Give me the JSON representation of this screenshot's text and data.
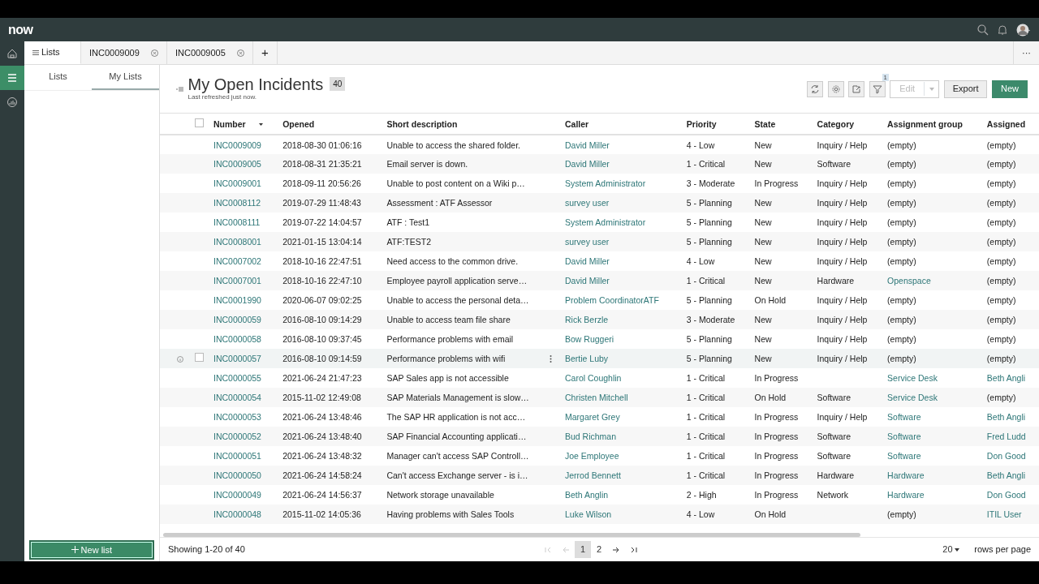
{
  "header": {
    "logo": "now"
  },
  "rail": [
    {
      "selected": false
    },
    {
      "selected": true
    },
    {
      "selected": false
    }
  ],
  "tabs": [
    {
      "label": "Lists",
      "kind": "menu",
      "selected": true
    },
    {
      "label": "INC0009009",
      "kind": "record",
      "selected": false
    },
    {
      "label": "INC0009005",
      "kind": "record",
      "selected": false
    },
    {
      "label": "+",
      "kind": "add",
      "selected": false
    }
  ],
  "more": "···",
  "panel_tabs": [
    {
      "label": "Lists",
      "selected": false
    },
    {
      "label": "My Lists",
      "selected": true
    }
  ],
  "new_list": "New list",
  "list": {
    "title": "My Open Incidents",
    "count": "40",
    "refreshed": "Last refreshed just now.",
    "filter_badge": "1",
    "buttons": [
      {
        "label": "Edit",
        "kind": "split",
        "disabled": true
      },
      {
        "label": "Export",
        "kind": "plain",
        "disabled": false
      },
      {
        "label": "New",
        "kind": "primary",
        "disabled": false
      }
    ]
  },
  "table": {
    "select_all_checked": false,
    "columns": [
      {
        "label": "Number",
        "sorted": true
      },
      {
        "label": "Opened",
        "sorted": false
      },
      {
        "label": "Short description",
        "sorted": false
      },
      {
        "label": "Caller",
        "sorted": false
      },
      {
        "label": "Priority",
        "sorted": false
      },
      {
        "label": "State",
        "sorted": false
      },
      {
        "label": "Category",
        "sorted": false
      },
      {
        "label": "Assignment group",
        "sorted": false
      },
      {
        "label": "Assigned",
        "sorted": false
      }
    ],
    "rows": [
      {
        "hovered": false,
        "cells": [
          "INC0009009",
          "2018-08-30 01:06:16",
          "Unable to access the shared folder.",
          "David Miller",
          "4 - Low",
          "New",
          "Inquiry / Help",
          "(empty)",
          "(empty)"
        ],
        "links": [
          true,
          false,
          false,
          true,
          false,
          false,
          false,
          false,
          false
        ]
      },
      {
        "hovered": false,
        "cells": [
          "INC0009005",
          "2018-08-31 21:35:21",
          "Email server is down.",
          "David Miller",
          "1 - Critical",
          "New",
          "Software",
          "(empty)",
          "(empty)"
        ],
        "links": [
          true,
          false,
          false,
          true,
          false,
          false,
          false,
          false,
          false
        ]
      },
      {
        "hovered": false,
        "cells": [
          "INC0009001",
          "2018-09-11 20:56:26",
          "Unable to post content on a Wiki p…",
          "System Administrator",
          "3 - Moderate",
          "In Progress",
          "Inquiry / Help",
          "(empty)",
          "(empty)"
        ],
        "links": [
          true,
          false,
          false,
          true,
          false,
          false,
          false,
          false,
          false
        ]
      },
      {
        "hovered": false,
        "cells": [
          "INC0008112",
          "2019-07-29 11:48:43",
          "Assessment :  ATF Assessor",
          "survey user",
          "5 - Planning",
          "New",
          "Inquiry / Help",
          "(empty)",
          "(empty)"
        ],
        "links": [
          true,
          false,
          false,
          true,
          false,
          false,
          false,
          false,
          false
        ]
      },
      {
        "hovered": false,
        "cells": [
          "INC0008111",
          "2019-07-22 14:04:57",
          "ATF : Test1",
          "System Administrator",
          "5 - Planning",
          "New",
          "Inquiry / Help",
          "(empty)",
          "(empty)"
        ],
        "links": [
          true,
          false,
          false,
          true,
          false,
          false,
          false,
          false,
          false
        ]
      },
      {
        "hovered": false,
        "cells": [
          "INC0008001",
          "2021-01-15 13:04:14",
          "ATF:TEST2",
          "survey user",
          "5 - Planning",
          "New",
          "Inquiry / Help",
          "(empty)",
          "(empty)"
        ],
        "links": [
          true,
          false,
          false,
          true,
          false,
          false,
          false,
          false,
          false
        ]
      },
      {
        "hovered": false,
        "cells": [
          "INC0007002",
          "2018-10-16 22:47:51",
          "Need access to the common drive.",
          "David Miller",
          "4 - Low",
          "New",
          "Inquiry / Help",
          "(empty)",
          "(empty)"
        ],
        "links": [
          true,
          false,
          false,
          true,
          false,
          false,
          false,
          false,
          false
        ]
      },
      {
        "hovered": false,
        "cells": [
          "INC0007001",
          "2018-10-16 22:47:10",
          "Employee payroll application serve…",
          "David Miller",
          "1 - Critical",
          "New",
          "Hardware",
          "Openspace",
          "(empty)"
        ],
        "links": [
          true,
          false,
          false,
          true,
          false,
          false,
          false,
          true,
          false
        ]
      },
      {
        "hovered": false,
        "cells": [
          "INC0001990",
          "2020-06-07 09:02:25",
          "Unable to access the personal deta…",
          "Problem CoordinatorATF",
          "5 - Planning",
          "On Hold",
          "Inquiry / Help",
          "(empty)",
          "(empty)"
        ],
        "links": [
          true,
          false,
          false,
          true,
          false,
          false,
          false,
          false,
          false
        ]
      },
      {
        "hovered": false,
        "cells": [
          "INC0000059",
          "2016-08-10 09:14:29",
          "Unable to access team file share",
          "Rick Berzle",
          "3 - Moderate",
          "New",
          "Inquiry / Help",
          "(empty)",
          "(empty)"
        ],
        "links": [
          true,
          false,
          false,
          true,
          false,
          false,
          false,
          false,
          false
        ]
      },
      {
        "hovered": false,
        "cells": [
          "INC0000058",
          "2016-08-10 09:37:45",
          "Performance problems with email",
          "Bow Ruggeri",
          "5 - Planning",
          "New",
          "Inquiry / Help",
          "(empty)",
          "(empty)"
        ],
        "links": [
          true,
          false,
          false,
          true,
          false,
          false,
          false,
          false,
          false
        ]
      },
      {
        "hovered": true,
        "cells": [
          "INC0000057",
          "2016-08-10 09:14:59",
          "Performance problems with wifi",
          "Bertie Luby",
          "5 - Planning",
          "New",
          "Inquiry / Help",
          "(empty)",
          "(empty)"
        ],
        "links": [
          true,
          false,
          false,
          true,
          false,
          false,
          false,
          false,
          false
        ]
      },
      {
        "hovered": false,
        "cells": [
          "INC0000055",
          "2021-06-24 21:47:23",
          "SAP Sales app is not accessible",
          "Carol Coughlin",
          "1 - Critical",
          "In Progress",
          "",
          "Service Desk",
          "Beth Angli"
        ],
        "links": [
          true,
          false,
          false,
          true,
          false,
          false,
          false,
          true,
          true
        ]
      },
      {
        "hovered": false,
        "cells": [
          "INC0000054",
          "2015-11-02 12:49:08",
          "SAP Materials Management is slow…",
          "Christen Mitchell",
          "1 - Critical",
          "On Hold",
          "Software",
          "Service Desk",
          "(empty)"
        ],
        "links": [
          true,
          false,
          false,
          true,
          false,
          false,
          false,
          true,
          false
        ]
      },
      {
        "hovered": false,
        "cells": [
          "INC0000053",
          "2021-06-24 13:48:46",
          "The SAP HR application is not acc…",
          "Margaret Grey",
          "1 - Critical",
          "In Progress",
          "Inquiry / Help",
          "Software",
          "Beth Angli"
        ],
        "links": [
          true,
          false,
          false,
          true,
          false,
          false,
          false,
          true,
          true
        ]
      },
      {
        "hovered": false,
        "cells": [
          "INC0000052",
          "2021-06-24 13:48:40",
          "SAP Financial Accounting applicati…",
          "Bud Richman",
          "1 - Critical",
          "In Progress",
          "Software",
          "Software",
          "Fred Ludd"
        ],
        "links": [
          true,
          false,
          false,
          true,
          false,
          false,
          false,
          true,
          true
        ]
      },
      {
        "hovered": false,
        "cells": [
          "INC0000051",
          "2021-06-24 13:48:32",
          "Manager can't access SAP Controll…",
          "Joe Employee",
          "1 - Critical",
          "In Progress",
          "Software",
          "Software",
          "Don Good"
        ],
        "links": [
          true,
          false,
          false,
          true,
          false,
          false,
          false,
          true,
          true
        ]
      },
      {
        "hovered": false,
        "cells": [
          "INC0000050",
          "2021-06-24 14:58:24",
          "Can't access Exchange server - is i…",
          "Jerrod Bennett",
          "1 - Critical",
          "In Progress",
          "Hardware",
          "Hardware",
          "Beth Angli"
        ],
        "links": [
          true,
          false,
          false,
          true,
          false,
          false,
          false,
          true,
          true
        ]
      },
      {
        "hovered": false,
        "cells": [
          "INC0000049",
          "2021-06-24 14:56:37",
          "Network storage unavailable",
          "Beth Anglin",
          "2 - High",
          "In Progress",
          "Network",
          "Hardware",
          "Don Good"
        ],
        "links": [
          true,
          false,
          false,
          true,
          false,
          false,
          false,
          true,
          true
        ]
      },
      {
        "hovered": false,
        "cells": [
          "INC0000048",
          "2015-11-02 14:05:36",
          "Having problems with Sales Tools",
          "Luke Wilson",
          "4 - Low",
          "On Hold",
          "",
          "(empty)",
          "ITIL User"
        ],
        "links": [
          true,
          false,
          false,
          true,
          false,
          false,
          false,
          false,
          true
        ]
      }
    ]
  },
  "footer": {
    "showing": "Showing 1-20 of 40",
    "pages": [
      {
        "label": "1",
        "selected": true
      },
      {
        "label": "2",
        "selected": false
      }
    ],
    "rows_value": "20",
    "rows_label": "rows per page"
  }
}
